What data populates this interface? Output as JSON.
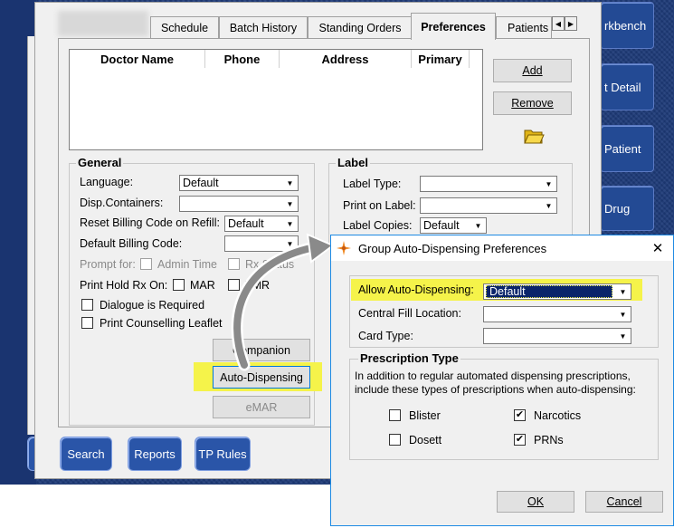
{
  "right_nav": [
    "rkbench",
    "t Detail",
    "Patient",
    "Drug"
  ],
  "tabs": [
    {
      "label": "Schedule"
    },
    {
      "label": "Batch History"
    },
    {
      "label": "Standing Orders"
    },
    {
      "label": "Preferences"
    },
    {
      "label": "Patients"
    }
  ],
  "doctor_table": {
    "columns": [
      "Doctor Name",
      "Phone",
      "Address",
      "Primary"
    ],
    "rows": []
  },
  "side_buttons": {
    "add": "Add",
    "remove": "Remove"
  },
  "general": {
    "title": "General",
    "language_label": "Language:",
    "language_value": "Default",
    "disp_containers_label": "Disp.Containers:",
    "disp_containers_value": "",
    "reset_billing_label": "Reset Billing Code on Refill:",
    "reset_billing_value": "Default",
    "default_billing_label": "Default Billing Code:",
    "default_billing_value": "",
    "prompt_for_label": "Prompt for:",
    "admin_time_label": "Admin Time",
    "rx_status_label": "Rx Status",
    "print_hold_label": "Print Hold Rx On:",
    "mar_label": "MAR",
    "tmr_label": "TMR",
    "dialogue_required_label": "Dialogue is Required",
    "print_counselling_label": "Print Counselling Leaflet",
    "companion_button": "Companion",
    "auto_dispensing_button": "Auto-Dispensing",
    "emar_button": "eMAR"
  },
  "label_group": {
    "title": "Label",
    "label_type_label": "Label Type:",
    "label_type_value": "",
    "print_on_label_label": "Print on Label:",
    "print_on_label_value": "",
    "label_copies_label": "Label Copies:",
    "label_copies_value": "Default"
  },
  "bottom_buttons": [
    "Search",
    "Reports",
    "TP Rules"
  ],
  "dialog": {
    "title": "Group Auto-Dispensing Preferences",
    "close": "✕",
    "allow_label": "Allow Auto-Dispensing:",
    "allow_value": "Default",
    "central_fill_label": "Central Fill Location:",
    "central_fill_value": "",
    "card_type_label": "Card Type:",
    "card_type_value": "",
    "prescription_type": {
      "title": "Prescription Type",
      "description_line1": "In addition to regular automated dispensing prescriptions,",
      "description_line2": "include these types of prescriptions when auto-dispensing:",
      "blister": {
        "label": "Blister",
        "checked": false
      },
      "narcotics": {
        "label": "Narcotics",
        "checked": true
      },
      "dosett": {
        "label": "Dosett",
        "checked": false
      },
      "prns": {
        "label": "PRNs",
        "checked": true
      }
    },
    "ok_button": "OK",
    "cancel_button": "Cancel"
  },
  "colors": {
    "app_background": "#1d3a78",
    "highlight": "#f5f34a",
    "dialog_border": "#1e8ae3",
    "selection": "#0a246a"
  },
  "icons": [
    "folder-open-icon",
    "app-logo-icon",
    "close-icon",
    "chevron-down-icon",
    "curved-arrow-icon"
  ]
}
